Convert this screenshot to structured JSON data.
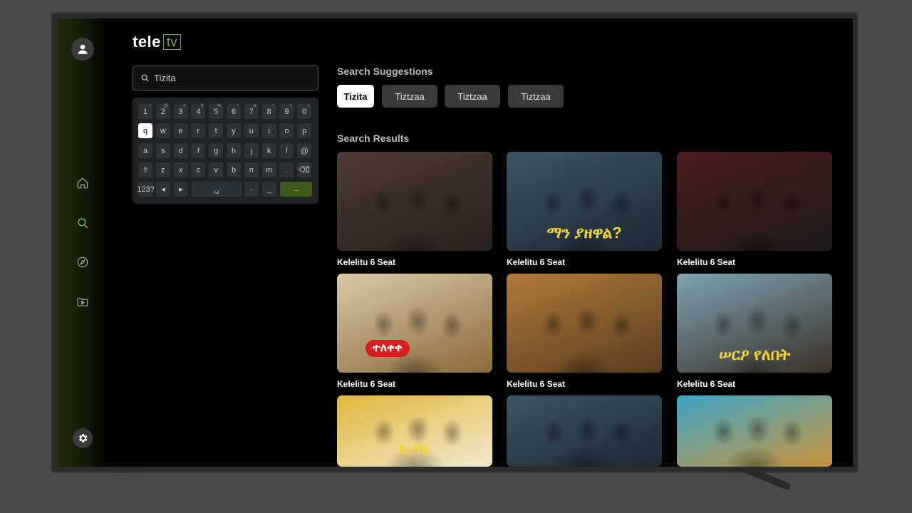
{
  "app": {
    "logo_left": "tele",
    "logo_right": "tv"
  },
  "search": {
    "value": "Tizita"
  },
  "keyboard": {
    "row1": [
      {
        "key": "1",
        "sup": "!"
      },
      {
        "key": "2",
        "sup": "@"
      },
      {
        "key": "3",
        "sup": "#"
      },
      {
        "key": "4",
        "sup": "$"
      },
      {
        "key": "5",
        "sup": "%"
      },
      {
        "key": "6",
        "sup": "^"
      },
      {
        "key": "7",
        "sup": "&"
      },
      {
        "key": "8",
        "sup": "*"
      },
      {
        "key": "9",
        "sup": "("
      },
      {
        "key": "0",
        "sup": ")"
      }
    ],
    "row2": [
      "q",
      "w",
      "e",
      "r",
      "t",
      "y",
      "u",
      "i",
      "o",
      "p"
    ],
    "row3": [
      "a",
      "s",
      "d",
      "f",
      "g",
      "h",
      "j",
      "k",
      "l",
      "@"
    ],
    "row4": [
      "⇧",
      "z",
      "x",
      "c",
      "v",
      "b",
      "n",
      "m",
      ".",
      "⌫"
    ],
    "row5": {
      "mode": "123?",
      "left": "◂",
      "right": "▸",
      "space": "␣",
      "dash": "-",
      "underscore": "_",
      "enter": "→"
    },
    "selected_key": "q"
  },
  "suggestions": {
    "heading": "Search Suggestions",
    "items": [
      "Tizita",
      "Tiztzaa",
      "Tiztzaa",
      "Tiztzaa"
    ]
  },
  "results": {
    "heading": "Search Results",
    "items": [
      {
        "title": "Kelelitu 6 Seat",
        "colors": [
          "#4a3a33",
          "#2a2220"
        ],
        "overlay": ""
      },
      {
        "title": "Kelelitu 6 Seat",
        "colors": [
          "#3b5566",
          "#1d2a33"
        ],
        "overlay": "ማን ያዘዋል?"
      },
      {
        "title": "Kelelitu 6 Seat",
        "colors": [
          "#4a1d1d",
          "#1c1a1c"
        ],
        "overlay": ""
      },
      {
        "title": "Kelelitu 6 Seat",
        "colors": [
          "#d9c9a8",
          "#8a6a3a"
        ],
        "overlay": "ተለቀቀ"
      },
      {
        "title": "Kelelitu 6 Seat",
        "colors": [
          "#b07a3a",
          "#5a3d1e"
        ],
        "overlay": ""
      },
      {
        "title": "Kelelitu 6 Seat",
        "colors": [
          "#7ea3b0",
          "#3a3028"
        ],
        "overlay": "ሠርዖ የለበት"
      },
      {
        "title": "",
        "colors": [
          "#e0b83a",
          "#f2e8cf"
        ],
        "overlay": "ኪዳዬ"
      },
      {
        "title": "",
        "colors": [
          "#3b5566",
          "#1d2a33"
        ],
        "overlay": ""
      },
      {
        "title": "",
        "colors": [
          "#3ea6c8",
          "#c8923a"
        ],
        "overlay": ""
      }
    ]
  }
}
